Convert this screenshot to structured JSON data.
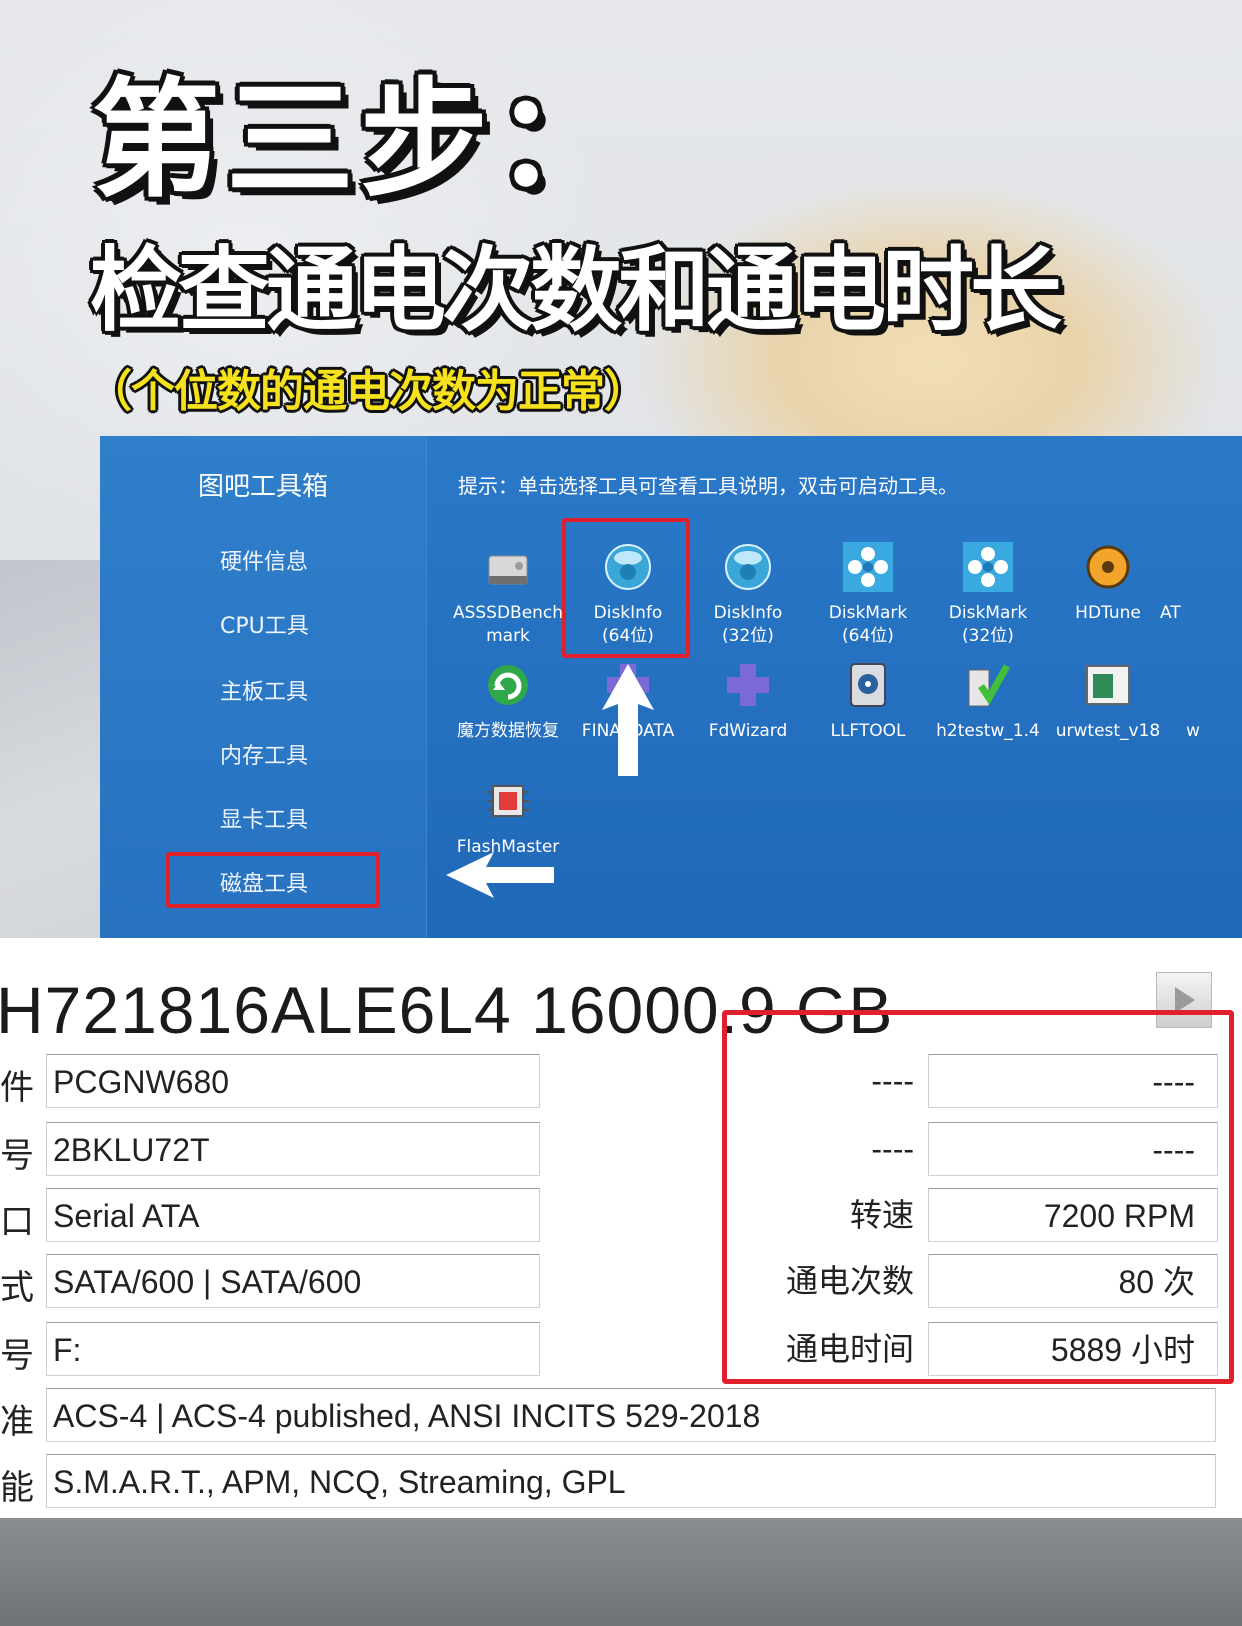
{
  "headings": {
    "step": "第三步：",
    "subtitle": "检查通电次数和通电时长",
    "note": "（个位数的通电次数为正常）"
  },
  "toolbox": {
    "title": "图吧工具箱",
    "hint": "提示：单击选择工具可查看工具说明，双击可启动工具。",
    "sidebar": [
      "硬件信息",
      "CPU工具",
      "主板工具",
      "内存工具",
      "显卡工具",
      "磁盘工具"
    ],
    "selected_sidebar": "磁盘工具",
    "tools": [
      {
        "name": "ASSSDBench",
        "sub": "mark",
        "icon": "ssd-drive-icon"
      },
      {
        "name": "DiskInfo",
        "sub": "(64位)",
        "icon": "crystal-ball-icon"
      },
      {
        "name": "DiskInfo",
        "sub": "(32位)",
        "icon": "crystal-ball-icon"
      },
      {
        "name": "DiskMark",
        "sub": "(64位)",
        "icon": "flower-icon"
      },
      {
        "name": "DiskMark",
        "sub": "(32位)",
        "icon": "flower-icon"
      },
      {
        "name": "HDTune",
        "sub": "",
        "icon": "hard-disk-icon"
      },
      {
        "name": "AT",
        "sub": "",
        "icon": ""
      },
      {
        "name": "魔方数据恢复",
        "sub": "",
        "icon": "recovery-icon"
      },
      {
        "name": "FINALDATA",
        "sub": "",
        "icon": "puzzle-icon"
      },
      {
        "name": "FdWizard",
        "sub": "",
        "icon": "puzzle-icon"
      },
      {
        "name": "LLFTOOL",
        "sub": "",
        "icon": "disk-tool-icon"
      },
      {
        "name": "h2testw_1.4",
        "sub": "",
        "icon": "checkmark-icon"
      },
      {
        "name": "urwtest_v18",
        "sub": "",
        "icon": "window-test-icon"
      },
      {
        "name": "w",
        "sub": "",
        "icon": ""
      },
      {
        "name": "FlashMaster",
        "sub": "",
        "icon": "chip-icon"
      }
    ]
  },
  "diskinfo": {
    "model": "H721816ALE6L4 16000.9 GB",
    "rows": [
      {
        "label": "件",
        "value": "PCGNW680"
      },
      {
        "label": "号",
        "value": "2BKLU72T"
      },
      {
        "label": "口",
        "value": "Serial ATA"
      },
      {
        "label": "式",
        "value": "SATA/600 | SATA/600"
      },
      {
        "label": "号",
        "value": "F:"
      },
      {
        "label": "准",
        "value": "ACS-4 | ACS-4 published, ANSI INCITS 529-2018"
      },
      {
        "label": "能",
        "value": "S.M.A.R.T., APM, NCQ, Streaming, GPL"
      }
    ],
    "right": [
      {
        "label": "----",
        "value": "----"
      },
      {
        "label": "----",
        "value": "----"
      },
      {
        "label": "转速",
        "value": "7200 RPM"
      },
      {
        "label": "通电次数",
        "value": "80 次"
      },
      {
        "label": "通电时间",
        "value": "5889 小时"
      }
    ]
  },
  "colors": {
    "highlight": "#e0202a",
    "toolbox_blue": "#2470bd",
    "note_yellow": "#f6e21c"
  }
}
